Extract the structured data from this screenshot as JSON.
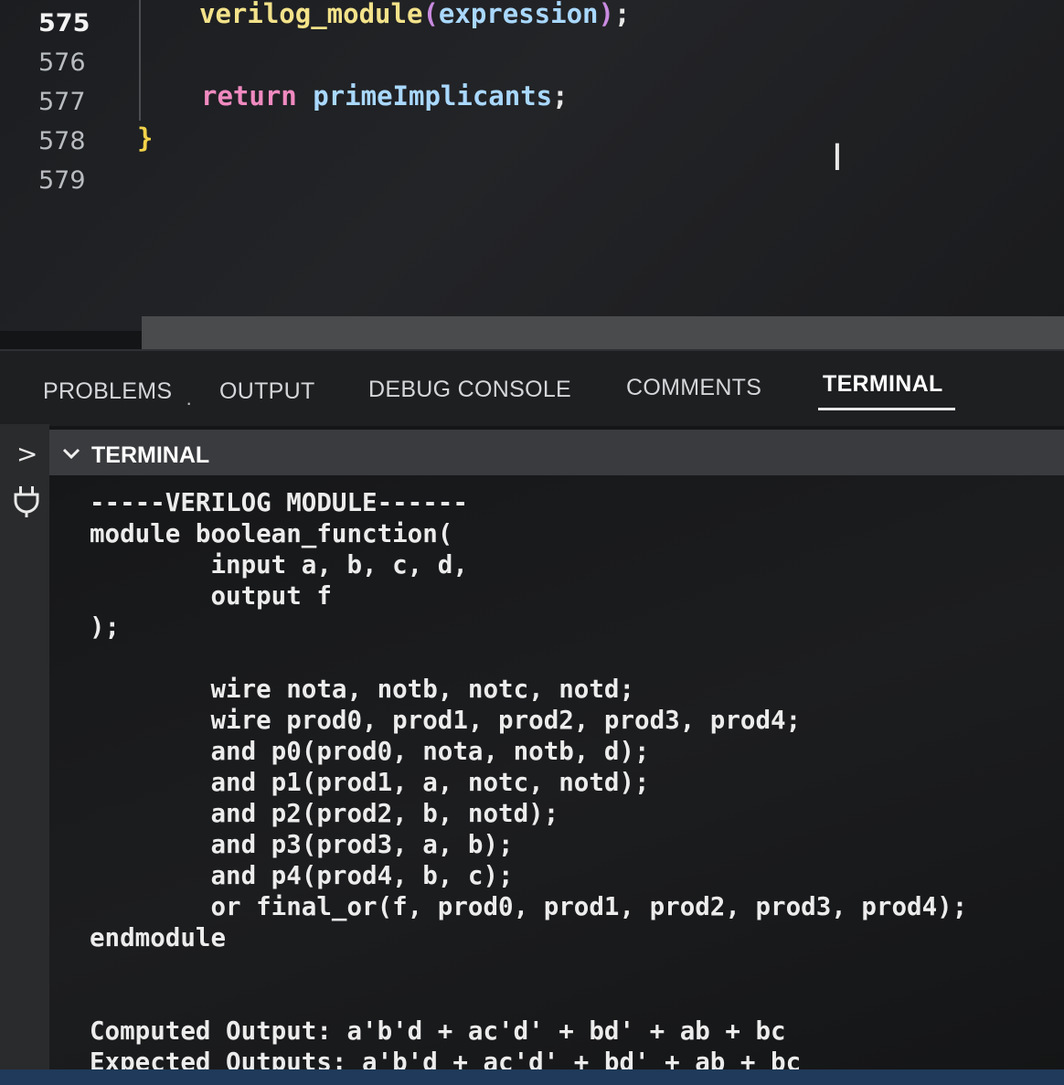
{
  "editor": {
    "line_numbers": [
      "575",
      "576",
      "577",
      "578",
      "579"
    ],
    "active_line": "575",
    "code": {
      "l575_fn": "verilog_module",
      "l575_open": "(",
      "l575_arg": "expression",
      "l575_close": ")",
      "l575_semi": ";",
      "l577_kw": "return",
      "l577_id": "primeImplicants",
      "l577_semi": ";",
      "l578_brace": "}"
    },
    "cursor_glyph": "I"
  },
  "panel": {
    "tabs": [
      {
        "label": "PROBLEMS",
        "active": false
      },
      {
        "label": "OUTPUT",
        "active": false
      },
      {
        "label": "DEBUG CONSOLE",
        "active": false
      },
      {
        "label": "COMMENTS",
        "active": false
      },
      {
        "label": "TERMINAL",
        "active": true
      }
    ],
    "separator": "·"
  },
  "terminal": {
    "header_title": "TERMINAL",
    "lines": [
      "-----VERILOG MODULE------",
      "module boolean_function(",
      "        input a, b, c, d,",
      "        output f",
      ");",
      "",
      "        wire nota, notb, notc, notd;",
      "        wire prod0, prod1, prod2, prod3, prod4;",
      "        and p0(prod0, nota, notb, d);",
      "        and p1(prod1, a, notc, notd);",
      "        and p2(prod2, b, notd);",
      "        and p3(prod3, a, b);",
      "        and p4(prod4, b, c);",
      "        or final_or(f, prod0, prod1, prod2, prod3, prod4);",
      "endmodule",
      "",
      "",
      "Computed Output: a'b'd + ac'd' + bd' + ab + bc",
      "Expected Outputs: a'b'd + ac'd' + bd' + ab + bc"
    ]
  },
  "icons": {
    "chevron_right": "chevron-right-icon",
    "chevron_down": "chevron-down-icon",
    "plug": "plug-icon"
  },
  "colors": {
    "function": "#f3e28a",
    "keyword": "#f08ac0",
    "identifier": "#a9d8ff",
    "brace": "#f2d34a"
  }
}
